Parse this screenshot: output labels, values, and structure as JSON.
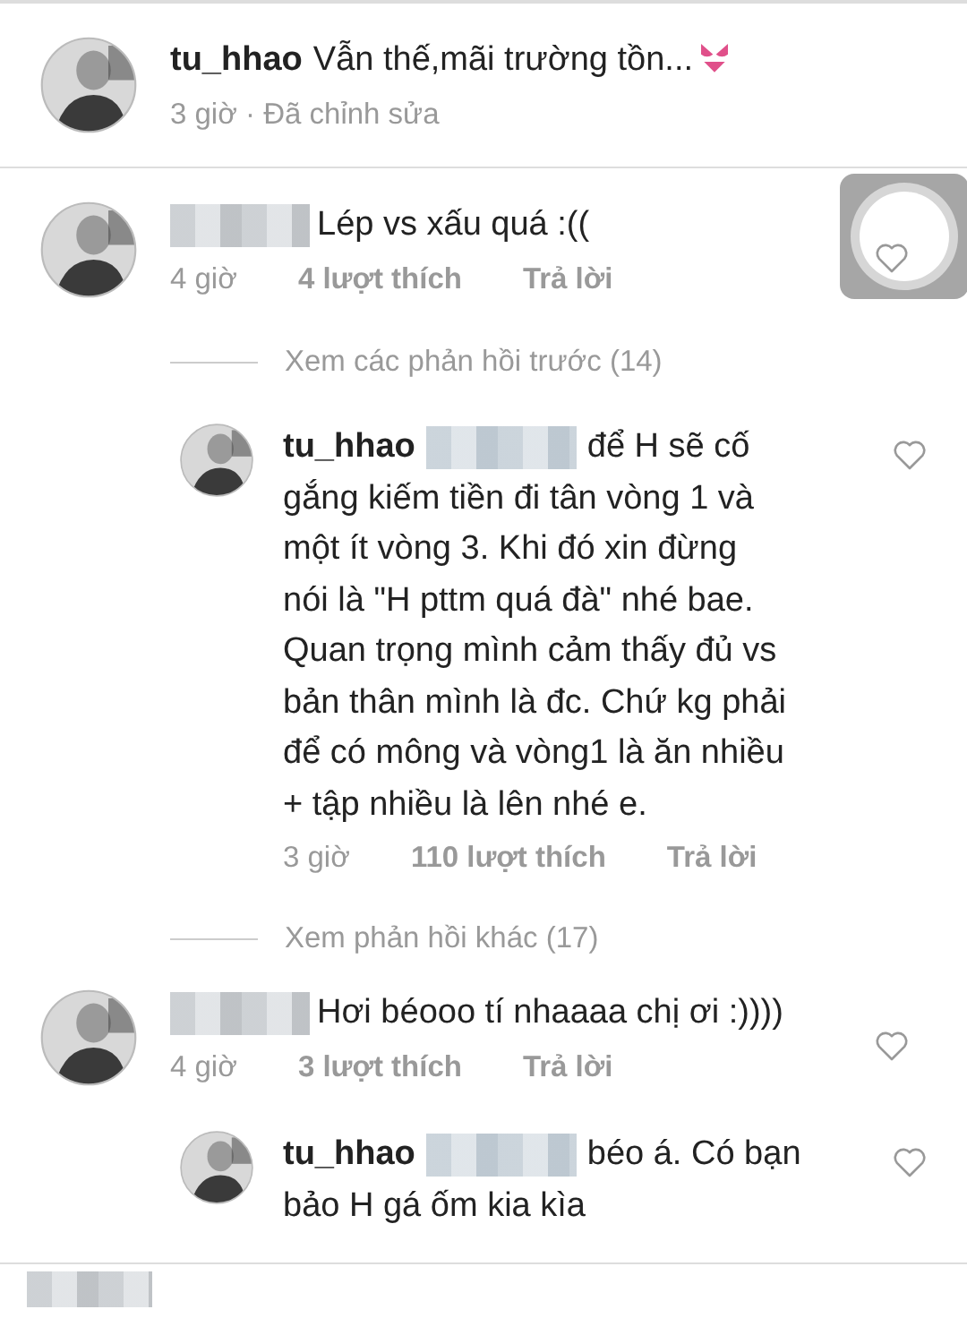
{
  "comments": [
    {
      "kind": "comment",
      "author": "tu_hhao",
      "lines": [
        "Vẫn thế,mãi trường tồn..."
      ],
      "has_emoji": true,
      "time": "3 giờ · Đã chỉnh sửa",
      "divider_after": true
    },
    {
      "kind": "comment",
      "author_blurred": true,
      "lines": [
        "Lép vs xấu quá :(("
      ],
      "time": "4 giờ",
      "likes": "4 lượt thích",
      "reply": "Trả lời",
      "liked": false
    },
    {
      "kind": "more",
      "label": "Xem các phản hồi trước (14)"
    },
    {
      "kind": "reply",
      "author": "tu_hhao",
      "mention_blurred": true,
      "lines": [
        "để H sẽ cố",
        "gắng kiếm tiền đi tân vòng 1 và",
        "một ít vòng 3. Khi đó xin đừng",
        "nói là \"H pttm quá đà\" nhé bae.",
        "Quan trọng mình cảm thấy đủ vs",
        "bản thân mình là đc. Chứ kg phải",
        "để có mông và vòng1 là ăn nhiều",
        "+ tập nhiều là lên nhé e."
      ],
      "time": "3 giờ",
      "likes": "110 lượt thích",
      "reply": "Trả lời",
      "liked": false
    },
    {
      "kind": "more",
      "label": "Xem phản hồi khác (17)"
    },
    {
      "kind": "comment",
      "author_blurred": true,
      "lines": [
        "Hơi béooo tí nhaaaa chị ơi :))))"
      ],
      "time": "4 giờ",
      "likes": "3 lượt thích",
      "reply": "Trả lời",
      "liked": false
    },
    {
      "kind": "reply",
      "author": "tu_hhao",
      "mention_blurred": true,
      "lines": [
        "béo á. Có bạn",
        "bảo H gá ốm kia kìa"
      ],
      "liked": false
    }
  ],
  "floating_button": {
    "visible": true
  },
  "bottom_bar": {
    "author_blurred": true
  }
}
